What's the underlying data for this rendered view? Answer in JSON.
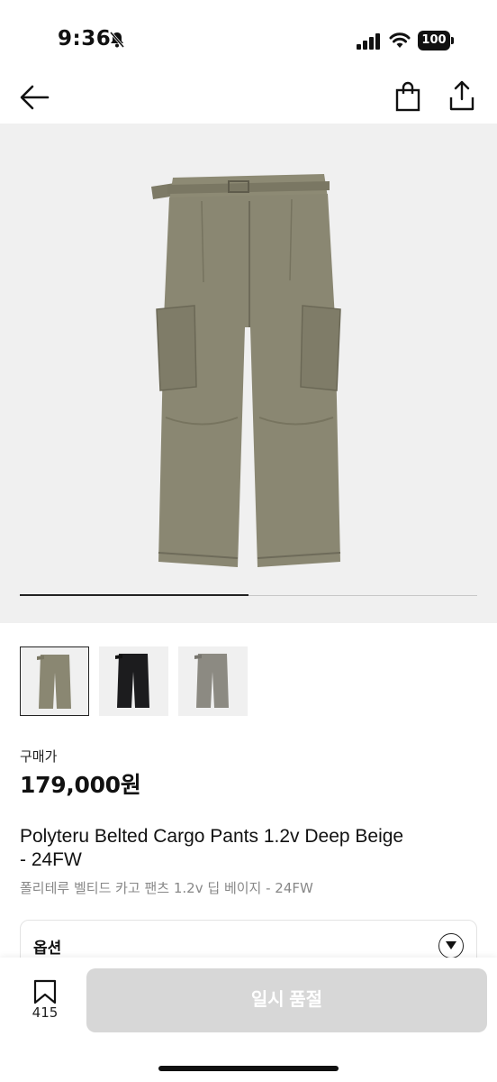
{
  "status_bar": {
    "time": "9:36",
    "battery": "100"
  },
  "nav": {
    "back_icon": "arrow-left-icon",
    "bag_icon": "shopping-bag-icon",
    "share_icon": "share-icon"
  },
  "gallery": {
    "slide_progress": 0.5,
    "thumbnails": [
      {
        "color": "#8a8772",
        "selected": true
      },
      {
        "color": "#1c1c1e",
        "selected": false
      },
      {
        "color": "#8c8a82",
        "selected": false
      }
    ]
  },
  "product": {
    "price_label": "구매가",
    "price": "179,000원",
    "title_en_line1": "Polyteru Belted Cargo Pants 1.2v Deep Beige",
    "title_en_line2": "- 24FW",
    "title_ko": "폴리테루 벨티드 카고 팬츠 1.2v 딥 베이지 - 24FW"
  },
  "option": {
    "label": "옵션"
  },
  "bottom_bar": {
    "bookmark_count": "415",
    "buy_label": "일시 품절"
  },
  "colors": {
    "hero_bg": "#f0f0f0",
    "disabled_button": "#d7d7d7",
    "pants_main": "#8a8772"
  }
}
